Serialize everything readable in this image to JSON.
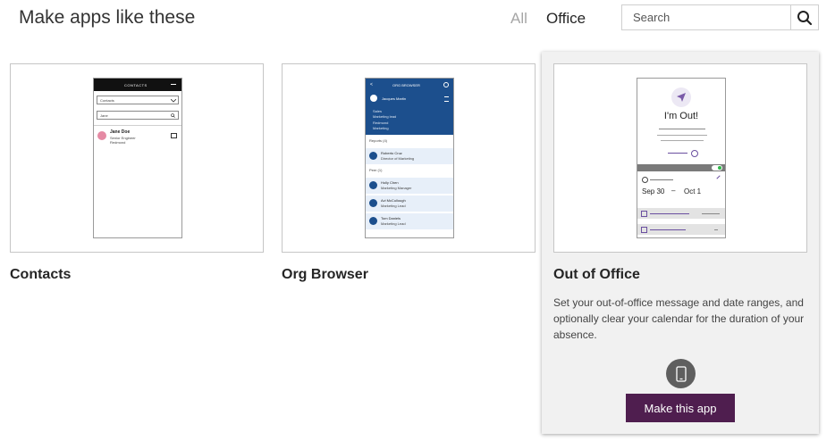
{
  "header": {
    "title": "Make apps like these",
    "filters": {
      "all": "All",
      "office": "Office"
    },
    "search": {
      "placeholder": "Search",
      "value": ""
    }
  },
  "templates": [
    {
      "name": "Contacts",
      "preview": {
        "header": "CONTACTS",
        "dropdown": "Contacts",
        "search_text": "Jane",
        "contact_name": "Jane Doe",
        "contact_line1": "Senior Engineer",
        "contact_line2": "Redmond"
      }
    },
    {
      "name": "Org Browser",
      "preview": {
        "header": "ORG BROWSER",
        "manager_name": "Jacques Martin",
        "info1": "Sales",
        "info2": "Marketing lead",
        "info3": "Redmond",
        "info4": "Marketing",
        "section1": "Reports (4)",
        "person1_name": "Roberto Cruz",
        "person1_title": "Director of Marketing",
        "section2": "Peer (1)",
        "person2_name": "Holly Chen",
        "person2_title": "Marketing Manager",
        "person3_name": "Avi McCullough",
        "person3_title": "Marketing Lead",
        "person4_name": "Tom Daniels",
        "person4_title": "Marketing Lead"
      }
    },
    {
      "name": "Out of Office",
      "description": "Set your out-of-office message and date ranges, and optionally clear your calendar for the duration of your absence.",
      "preview": {
        "title": "I'm Out!",
        "start_date": "Sep 30",
        "end_date": "Oct 1"
      },
      "action_label": "Make this app"
    }
  ],
  "colors": {
    "accent_purple": "#4f1e4f",
    "org_blue": "#1c4f8d"
  },
  "icons": {
    "search": "magnifier-icon",
    "device": "phone-icon"
  }
}
